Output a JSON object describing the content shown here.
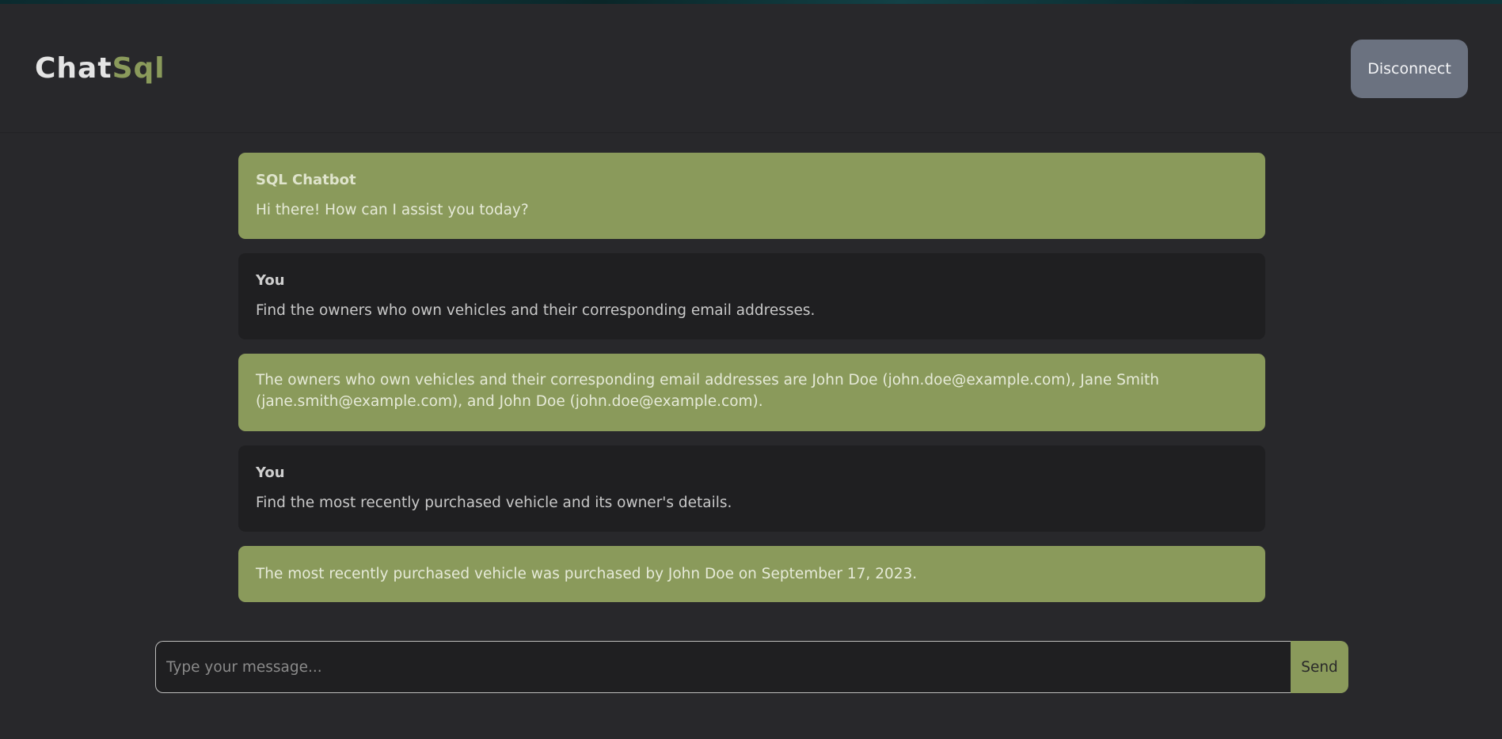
{
  "header": {
    "logo_part1": "Chat",
    "logo_part2": "Sql",
    "disconnect_label": "Disconnect"
  },
  "messages": [
    {
      "role": "bot",
      "sender": "SQL Chatbot",
      "text": "Hi there! How can I assist you today?"
    },
    {
      "role": "user",
      "sender": "You",
      "text": "Find the owners who own vehicles and their corresponding email addresses."
    },
    {
      "role": "bot",
      "sender": "",
      "text": "The owners who own vehicles and their corresponding email addresses are John Doe (john.doe@example.com), Jane Smith (jane.smith@example.com), and John Doe (john.doe@example.com)."
    },
    {
      "role": "user",
      "sender": "You",
      "text": "Find the most recently purchased vehicle and its owner's details."
    },
    {
      "role": "bot",
      "sender": "",
      "text": "The most recently purchased vehicle was purchased by John Doe on September 17, 2023."
    }
  ],
  "composer": {
    "placeholder": "Type your message...",
    "value": "",
    "send_label": "Send"
  },
  "colors": {
    "accent": "#8a9a5b",
    "background": "#28282b",
    "user_bubble": "#1f1f21",
    "disconnect_button": "#6b7280"
  }
}
